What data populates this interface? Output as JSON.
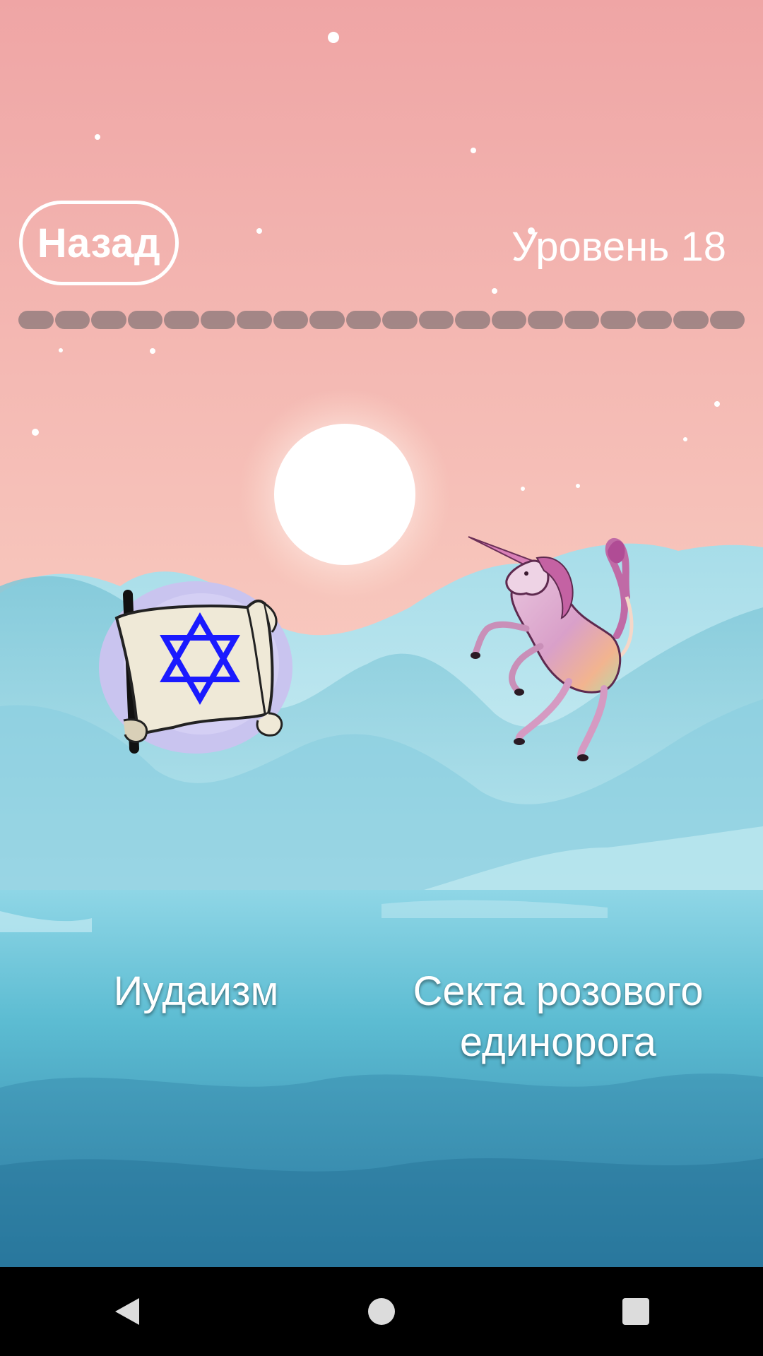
{
  "header": {
    "back_label": "Назад",
    "level_label": "Уровень 18"
  },
  "progress": {
    "segments_total": 20,
    "segments_filled": 0
  },
  "choices": [
    {
      "label": "Иудаизм",
      "icon": "torah-scroll-star-of-david-icon"
    },
    {
      "label": "Секта розового единорога",
      "icon": "pink-unicorn-icon"
    }
  ],
  "navbar": {
    "icons": [
      "back-triangle-icon",
      "home-circle-icon",
      "recents-square-icon"
    ]
  },
  "colors": {
    "sky_top": "#f0a9a8",
    "sky_bottom": "#fbd5c4",
    "water": "#4fb3cc",
    "progress_segment": "#9e8484",
    "star_of_david": "#1a1aff"
  }
}
